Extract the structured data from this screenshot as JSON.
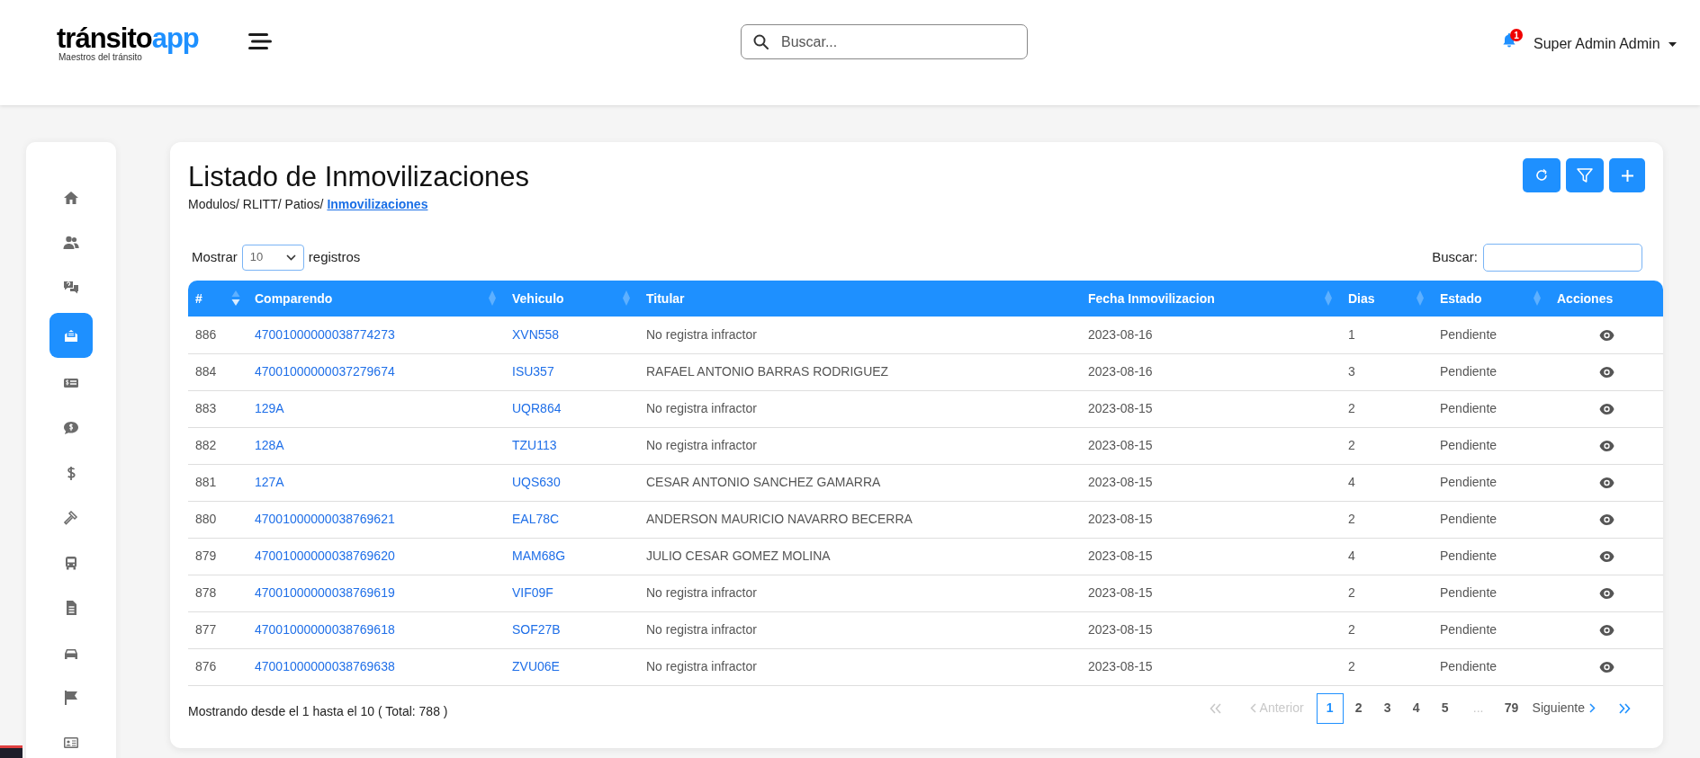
{
  "header": {
    "logo_main": "tránsito",
    "logo_accent": "app",
    "logo_tagline": "Maestros del tránsito",
    "search": {
      "placeholder": "Buscar..."
    },
    "notification_count": "1",
    "user": "Super Admin Admin"
  },
  "sidebar": {
    "items": [
      {
        "selected": false
      },
      {
        "selected": false
      },
      {
        "selected": false
      },
      {
        "selected": true
      },
      {
        "selected": false
      },
      {
        "selected": false
      },
      {
        "selected": false
      },
      {
        "selected": false
      },
      {
        "selected": false
      },
      {
        "selected": false
      },
      {
        "selected": false
      },
      {
        "selected": false
      },
      {
        "selected": false
      }
    ]
  },
  "page": {
    "title": "Listado de Inmovilizaciones",
    "breadcrumb": [
      "Modulos/",
      "RLITT/",
      "Patios/"
    ],
    "breadcrumb_current": "Inmovilizaciones"
  },
  "table_controls": {
    "show_label": "Mostrar",
    "page_size": "10",
    "records_label": "registros",
    "search_label": "Buscar:"
  },
  "table": {
    "columns": [
      {
        "label": "#",
        "sortable": true,
        "sorted": true
      },
      {
        "label": "Comparendo",
        "sortable": true,
        "sorted": false
      },
      {
        "label": "Vehiculo",
        "sortable": true,
        "sorted": false
      },
      {
        "label": "Titular",
        "sortable": false
      },
      {
        "label": "Fecha Inmovilizacion",
        "sortable": true,
        "sorted": false
      },
      {
        "label": "Dias",
        "sortable": true,
        "sorted": false
      },
      {
        "label": "Estado",
        "sortable": true,
        "sorted": false
      },
      {
        "label": "Acciones",
        "sortable": false
      }
    ],
    "rows": [
      {
        "id": "886",
        "comparendo": "47001000000038774273",
        "vehiculo": "XVN558",
        "titular": "No registra infractor",
        "fecha": "2023-08-16",
        "dias": "1",
        "estado": "Pendiente"
      },
      {
        "id": "884",
        "comparendo": "47001000000037279674",
        "vehiculo": "ISU357",
        "titular": "RAFAEL ANTONIO BARRAS RODRIGUEZ",
        "fecha": "2023-08-16",
        "dias": "3",
        "estado": "Pendiente"
      },
      {
        "id": "883",
        "comparendo": "129A",
        "vehiculo": "UQR864",
        "titular": "No registra infractor",
        "fecha": "2023-08-15",
        "dias": "2",
        "estado": "Pendiente"
      },
      {
        "id": "882",
        "comparendo": "128A",
        "vehiculo": "TZU113",
        "titular": "No registra infractor",
        "fecha": "2023-08-15",
        "dias": "2",
        "estado": "Pendiente"
      },
      {
        "id": "881",
        "comparendo": "127A",
        "vehiculo": "UQS630",
        "titular": "CESAR ANTONIO SANCHEZ GAMARRA",
        "fecha": "2023-08-15",
        "dias": "4",
        "estado": "Pendiente"
      },
      {
        "id": "880",
        "comparendo": "47001000000038769621",
        "vehiculo": "EAL78C",
        "titular": "ANDERSON MAURICIO NAVARRO BECERRA",
        "fecha": "2023-08-15",
        "dias": "2",
        "estado": "Pendiente"
      },
      {
        "id": "879",
        "comparendo": "47001000000038769620",
        "vehiculo": "MAM68G",
        "titular": "JULIO CESAR GOMEZ MOLINA",
        "fecha": "2023-08-15",
        "dias": "4",
        "estado": "Pendiente"
      },
      {
        "id": "878",
        "comparendo": "47001000000038769619",
        "vehiculo": "VIF09F",
        "titular": "No registra infractor",
        "fecha": "2023-08-15",
        "dias": "2",
        "estado": "Pendiente"
      },
      {
        "id": "877",
        "comparendo": "47001000000038769618",
        "vehiculo": "SOF27B",
        "titular": "No registra infractor",
        "fecha": "2023-08-15",
        "dias": "2",
        "estado": "Pendiente"
      },
      {
        "id": "876",
        "comparendo": "47001000000038769638",
        "vehiculo": "ZVU06E",
        "titular": "No registra infractor",
        "fecha": "2023-08-15",
        "dias": "2",
        "estado": "Pendiente"
      }
    ]
  },
  "footer": {
    "summary": "Mostrando desde el 1 hasta el 10 ( Total: 788 )"
  },
  "pagination": [
    {
      "kind": "first",
      "disabled": true
    },
    {
      "kind": "prev",
      "label": "Anterior",
      "disabled": true
    },
    {
      "kind": "page",
      "label": "1",
      "selected": true
    },
    {
      "kind": "page",
      "label": "2",
      "selected": false
    },
    {
      "kind": "page",
      "label": "3",
      "selected": false
    },
    {
      "kind": "page",
      "label": "4",
      "selected": false
    },
    {
      "kind": "page",
      "label": "5",
      "selected": false
    },
    {
      "kind": "ellipsis",
      "label": "..."
    },
    {
      "kind": "page",
      "label": "79",
      "selected": false
    },
    {
      "kind": "next",
      "label": "Siguiente",
      "disabled": false
    },
    {
      "kind": "last",
      "disabled": false
    }
  ]
}
